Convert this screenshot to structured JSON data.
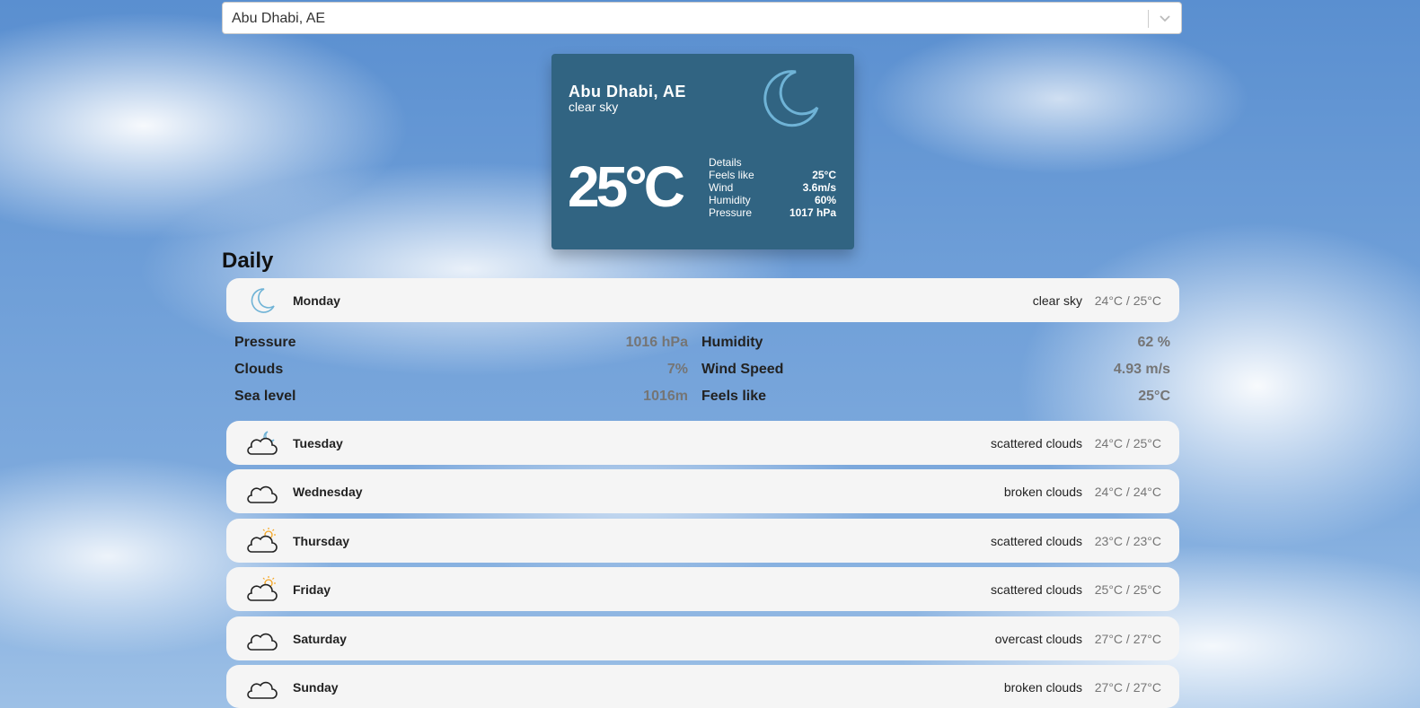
{
  "search": {
    "value": "Abu Dhabi, AE"
  },
  "current": {
    "city": "Abu Dhabi, AE",
    "description": "clear sky",
    "temperature": "25°C",
    "icon": "moon-icon",
    "details_title": "Details",
    "details": [
      {
        "label": "Feels like",
        "value": "25°C"
      },
      {
        "label": "Wind",
        "value": "3.6m/s"
      },
      {
        "label": "Humidity",
        "value": "60%"
      },
      {
        "label": "Pressure",
        "value": "1017 hPa"
      }
    ]
  },
  "daily": {
    "title": "Daily",
    "days": [
      {
        "name": "Monday",
        "condition": "clear sky",
        "range": "24°C / 25°C",
        "icon": "moon-icon"
      },
      {
        "name": "Tuesday",
        "condition": "scattered clouds",
        "range": "24°C / 25°C",
        "icon": "cloud-moon-icon"
      },
      {
        "name": "Wednesday",
        "condition": "broken clouds",
        "range": "24°C / 24°C",
        "icon": "cloud-icon"
      },
      {
        "name": "Thursday",
        "condition": "scattered clouds",
        "range": "23°C / 23°C",
        "icon": "cloud-sun-icon"
      },
      {
        "name": "Friday",
        "condition": "scattered clouds",
        "range": "25°C / 25°C",
        "icon": "cloud-sun-icon"
      },
      {
        "name": "Saturday",
        "condition": "overcast clouds",
        "range": "27°C / 27°C",
        "icon": "cloud-icon"
      },
      {
        "name": "Sunday",
        "condition": "broken clouds",
        "range": "27°C / 27°C",
        "icon": "cloud-icon"
      }
    ],
    "expanded": [
      {
        "label": "Pressure",
        "value": "1016 hPa"
      },
      {
        "label": "Humidity",
        "value": "62 %"
      },
      {
        "label": "Clouds",
        "value": "7%"
      },
      {
        "label": "Wind Speed",
        "value": "4.93 m/s"
      },
      {
        "label": "Sea level",
        "value": "1016m"
      },
      {
        "label": "Feels like",
        "value": "25°C"
      }
    ]
  },
  "colors": {
    "card": "#316482",
    "moon": "#6fb3d6",
    "sun": "#f5a623",
    "row": "#f5f5f5"
  }
}
